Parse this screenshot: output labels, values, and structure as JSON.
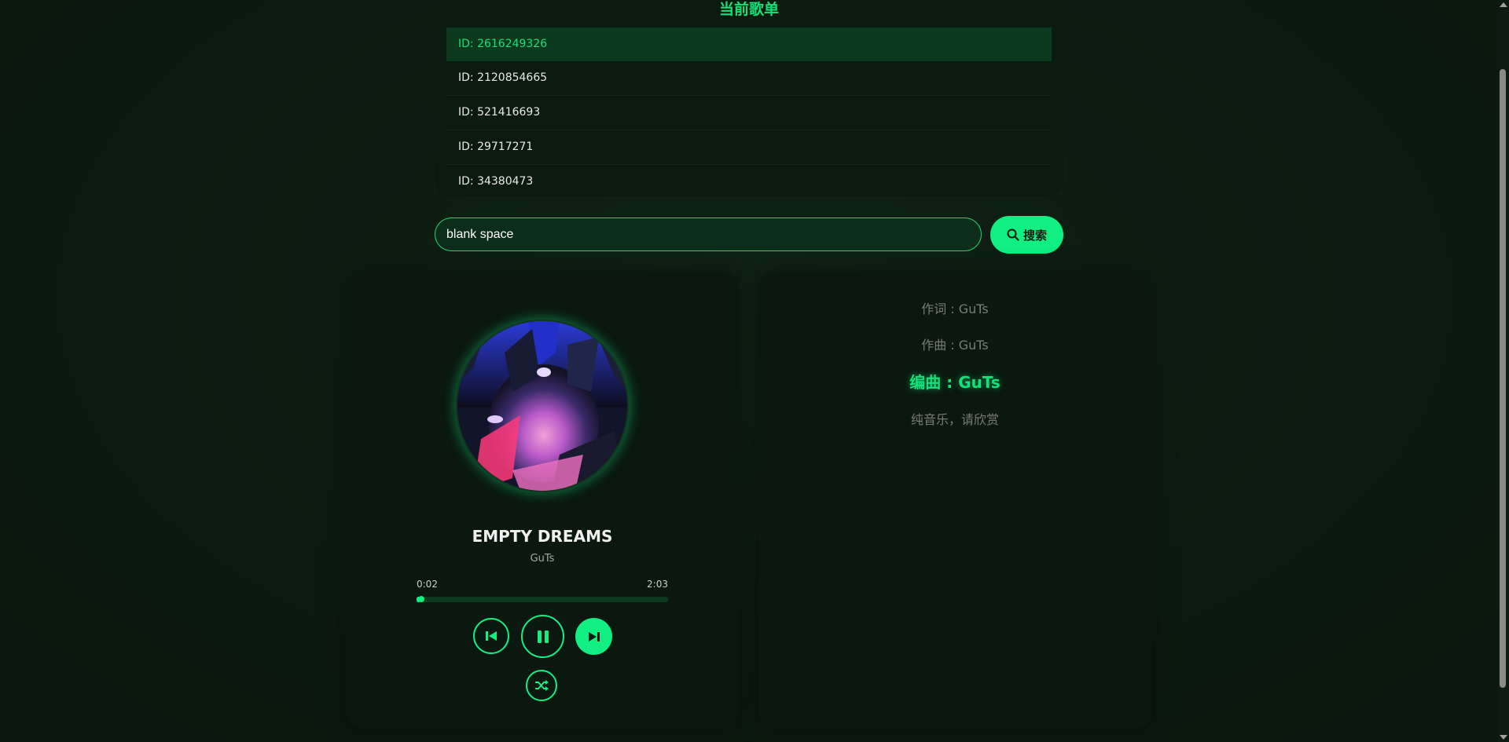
{
  "playlist": {
    "title": "当前歌单",
    "items": [
      {
        "label": "ID: 2616249326",
        "active": true
      },
      {
        "label": "ID: 2120854665",
        "active": false
      },
      {
        "label": "ID: 521416693",
        "active": false
      },
      {
        "label": "ID: 29717271",
        "active": false
      },
      {
        "label": "ID: 34380473",
        "active": false
      }
    ]
  },
  "search": {
    "value": "blank space",
    "button_label": "搜索",
    "icon": "search-icon"
  },
  "player": {
    "title": "EMPTY DREAMS",
    "artist": "GuTs",
    "current_time": "0:02",
    "total_time": "2:03",
    "progress_fraction": 0.016,
    "controls": [
      "prev-icon",
      "pause-icon",
      "next-icon",
      "shuffle-icon"
    ]
  },
  "lyrics": {
    "lines": [
      {
        "text": "作词 : GuTs",
        "active": false
      },
      {
        "text": "作曲 : GuTs",
        "active": false
      },
      {
        "text": "编曲 : GuTs",
        "active": true
      },
      {
        "text": "纯音乐，请欣赏",
        "active": false
      }
    ]
  },
  "colors": {
    "accent": "#11ee82",
    "background": "#0d1a11",
    "card": "#0a180f",
    "active_row": "#0b3a1f"
  }
}
